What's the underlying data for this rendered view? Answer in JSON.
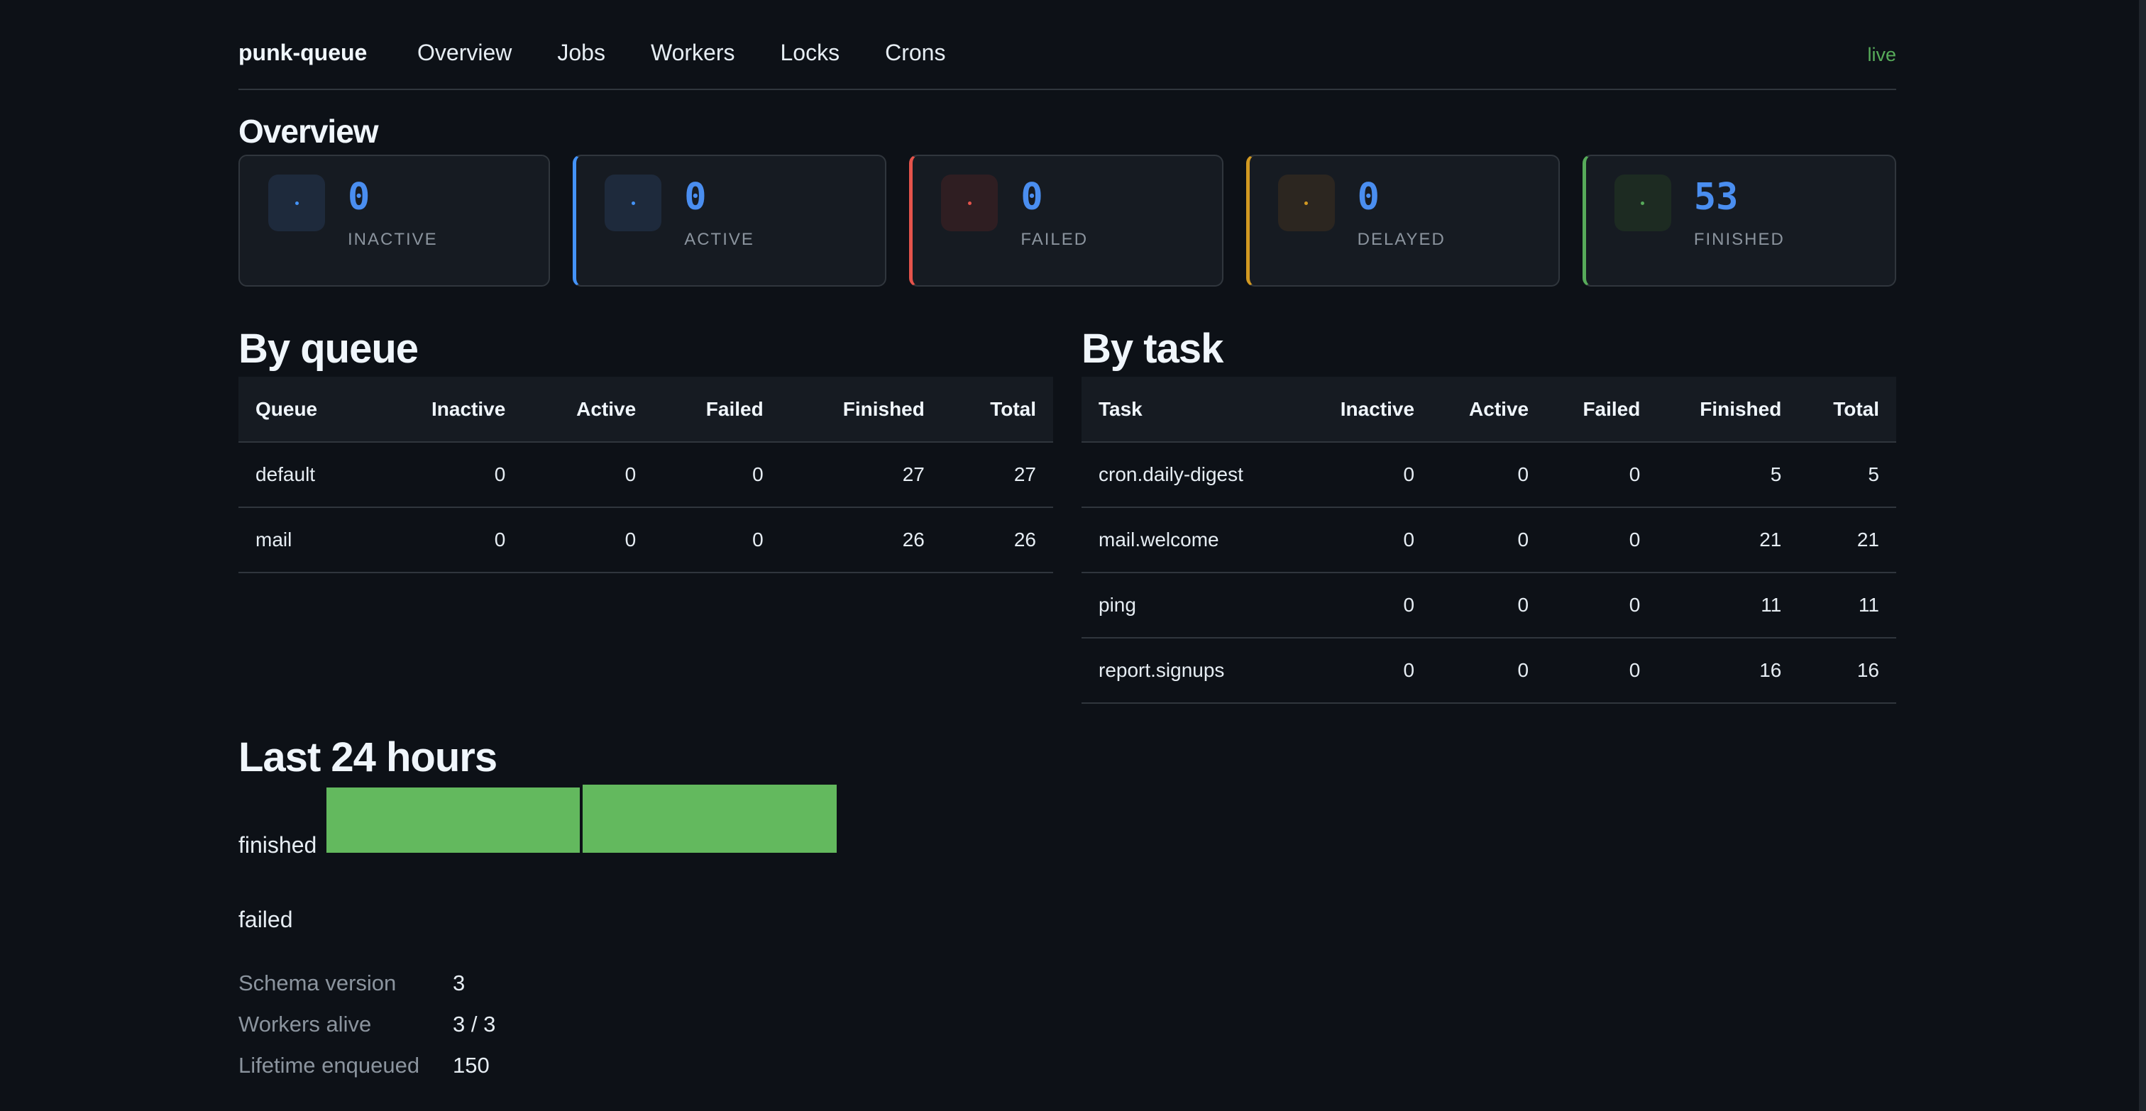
{
  "nav": {
    "brand": "punk-queue",
    "links": [
      "Overview",
      "Jobs",
      "Workers",
      "Locks",
      "Crons"
    ],
    "status": "live"
  },
  "overview": {
    "title": "Overview",
    "cards": [
      {
        "value": "0",
        "label": "INACTIVE",
        "color": "#4493f8"
      },
      {
        "value": "0",
        "label": "ACTIVE",
        "color": "#4493f8"
      },
      {
        "value": "0",
        "label": "FAILED",
        "color": "#e5534b"
      },
      {
        "value": "0",
        "label": "DELAYED",
        "color": "#d29922"
      },
      {
        "value": "53",
        "label": "FINISHED",
        "color": "#57ab5a"
      }
    ]
  },
  "by_queue": {
    "title": "By queue",
    "headers": [
      "Queue",
      "Inactive",
      "Active",
      "Failed",
      "Finished",
      "Total"
    ],
    "rows": [
      [
        "default",
        "0",
        "0",
        "0",
        "27",
        "27"
      ],
      [
        "mail",
        "0",
        "0",
        "0",
        "26",
        "26"
      ]
    ]
  },
  "by_task": {
    "title": "By task",
    "headers": [
      "Task",
      "Inactive",
      "Active",
      "Failed",
      "Finished",
      "Total"
    ],
    "rows": [
      [
        "cron.daily-digest",
        "0",
        "0",
        "0",
        "5",
        "5"
      ],
      [
        "mail.welcome",
        "0",
        "0",
        "0",
        "21",
        "21"
      ],
      [
        "ping",
        "0",
        "0",
        "0",
        "11",
        "11"
      ],
      [
        "report.signups",
        "0",
        "0",
        "0",
        "16",
        "16"
      ]
    ]
  },
  "last24": {
    "title": "Last 24 hours",
    "finished_label": "finished",
    "failed_label": "failed",
    "bar_color": "#63b95e"
  },
  "meta": [
    {
      "key": "Schema version",
      "value": "3"
    },
    {
      "key": "Workers alive",
      "value": "3 / 3"
    },
    {
      "key": "Lifetime enqueued",
      "value": "150"
    }
  ]
}
